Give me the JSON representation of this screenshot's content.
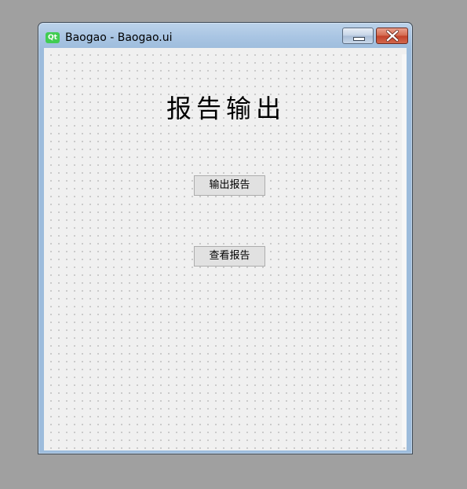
{
  "window": {
    "title": "Baogao - Baogao.ui",
    "app_icon_label": "Qt",
    "icon_color": "#41cd52",
    "controls": {
      "minimize_icon": "minimize-icon",
      "close_icon": "close-icon"
    }
  },
  "form": {
    "heading": "报告输出",
    "export_button_label": "输出报告",
    "view_button_label": "查看报告"
  }
}
